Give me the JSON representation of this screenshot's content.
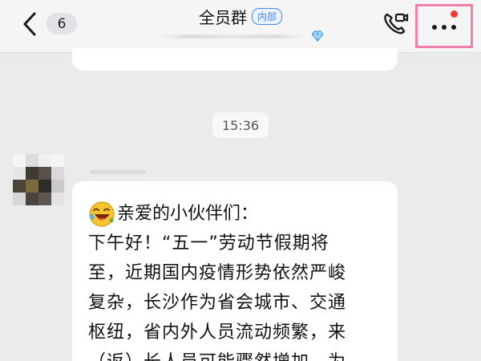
{
  "header": {
    "unread_count": "6",
    "title": "全员群",
    "group_tag": "内部",
    "more_button_highlight": "#f07fae",
    "notification_dot_color": "#f03a3a"
  },
  "icons": {
    "back": "chevron-left-icon",
    "subtitle_badge": "diamond-icon",
    "video_call": "phone-video-icon",
    "more": "more-dots-icon",
    "sticker": "laughing-face-emoji"
  },
  "messages": {
    "time_stamp": "15:36",
    "greeting": "亲爱的小伙伴们：",
    "body": "下午好！“五一”劳动节假期将\n至，近期国内疫情形势依然严峻\n复杂，长沙作为省会城市、交通\n枢纽，省内外人员流动频繁，来\n（返）长人员可能骤然增加，为"
  }
}
